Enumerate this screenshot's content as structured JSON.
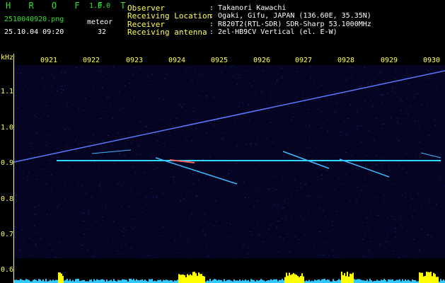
{
  "header": {
    "app_name": "H R O F F T",
    "version": "1.0.0",
    "filename": "2510040920.png",
    "datetime": "25.10.04 09:20",
    "meteor_label": "meteor",
    "meteor_count": "32"
  },
  "info": [
    {
      "key": "Observer",
      "value": ": Takanori Kawachi"
    },
    {
      "key": "Receiving Location",
      "value": ": Ogaki, Gifu, JAPAN (136.60E, 35.35N)"
    },
    {
      "key": "Receiver",
      "value": ": R820T2(RTL-SDR) SDR-Sharp 53.1000MHz"
    },
    {
      "key": "Receiving antenna",
      "value": ": 2el-HB9CV Vertical (el. E-W)"
    }
  ],
  "axes": {
    "y_unit": "kHz",
    "x_ticks": [
      "0921",
      "0922",
      "0923",
      "0924",
      "0925",
      "0926",
      "0927",
      "0928",
      "0929",
      "0930"
    ],
    "y_ticks": [
      "1.1",
      "1.0",
      "0.9",
      "0.8",
      "0.7",
      "0.6"
    ]
  },
  "colors": {
    "background": "#000000",
    "spectrogram_bg": "#050523",
    "label_yellow": "#ffff55",
    "label_green": "#2fe22f",
    "text_white": "#ffffff",
    "signal_cyan": "#30d8ff",
    "strip_yellow": "#ffff00"
  }
}
